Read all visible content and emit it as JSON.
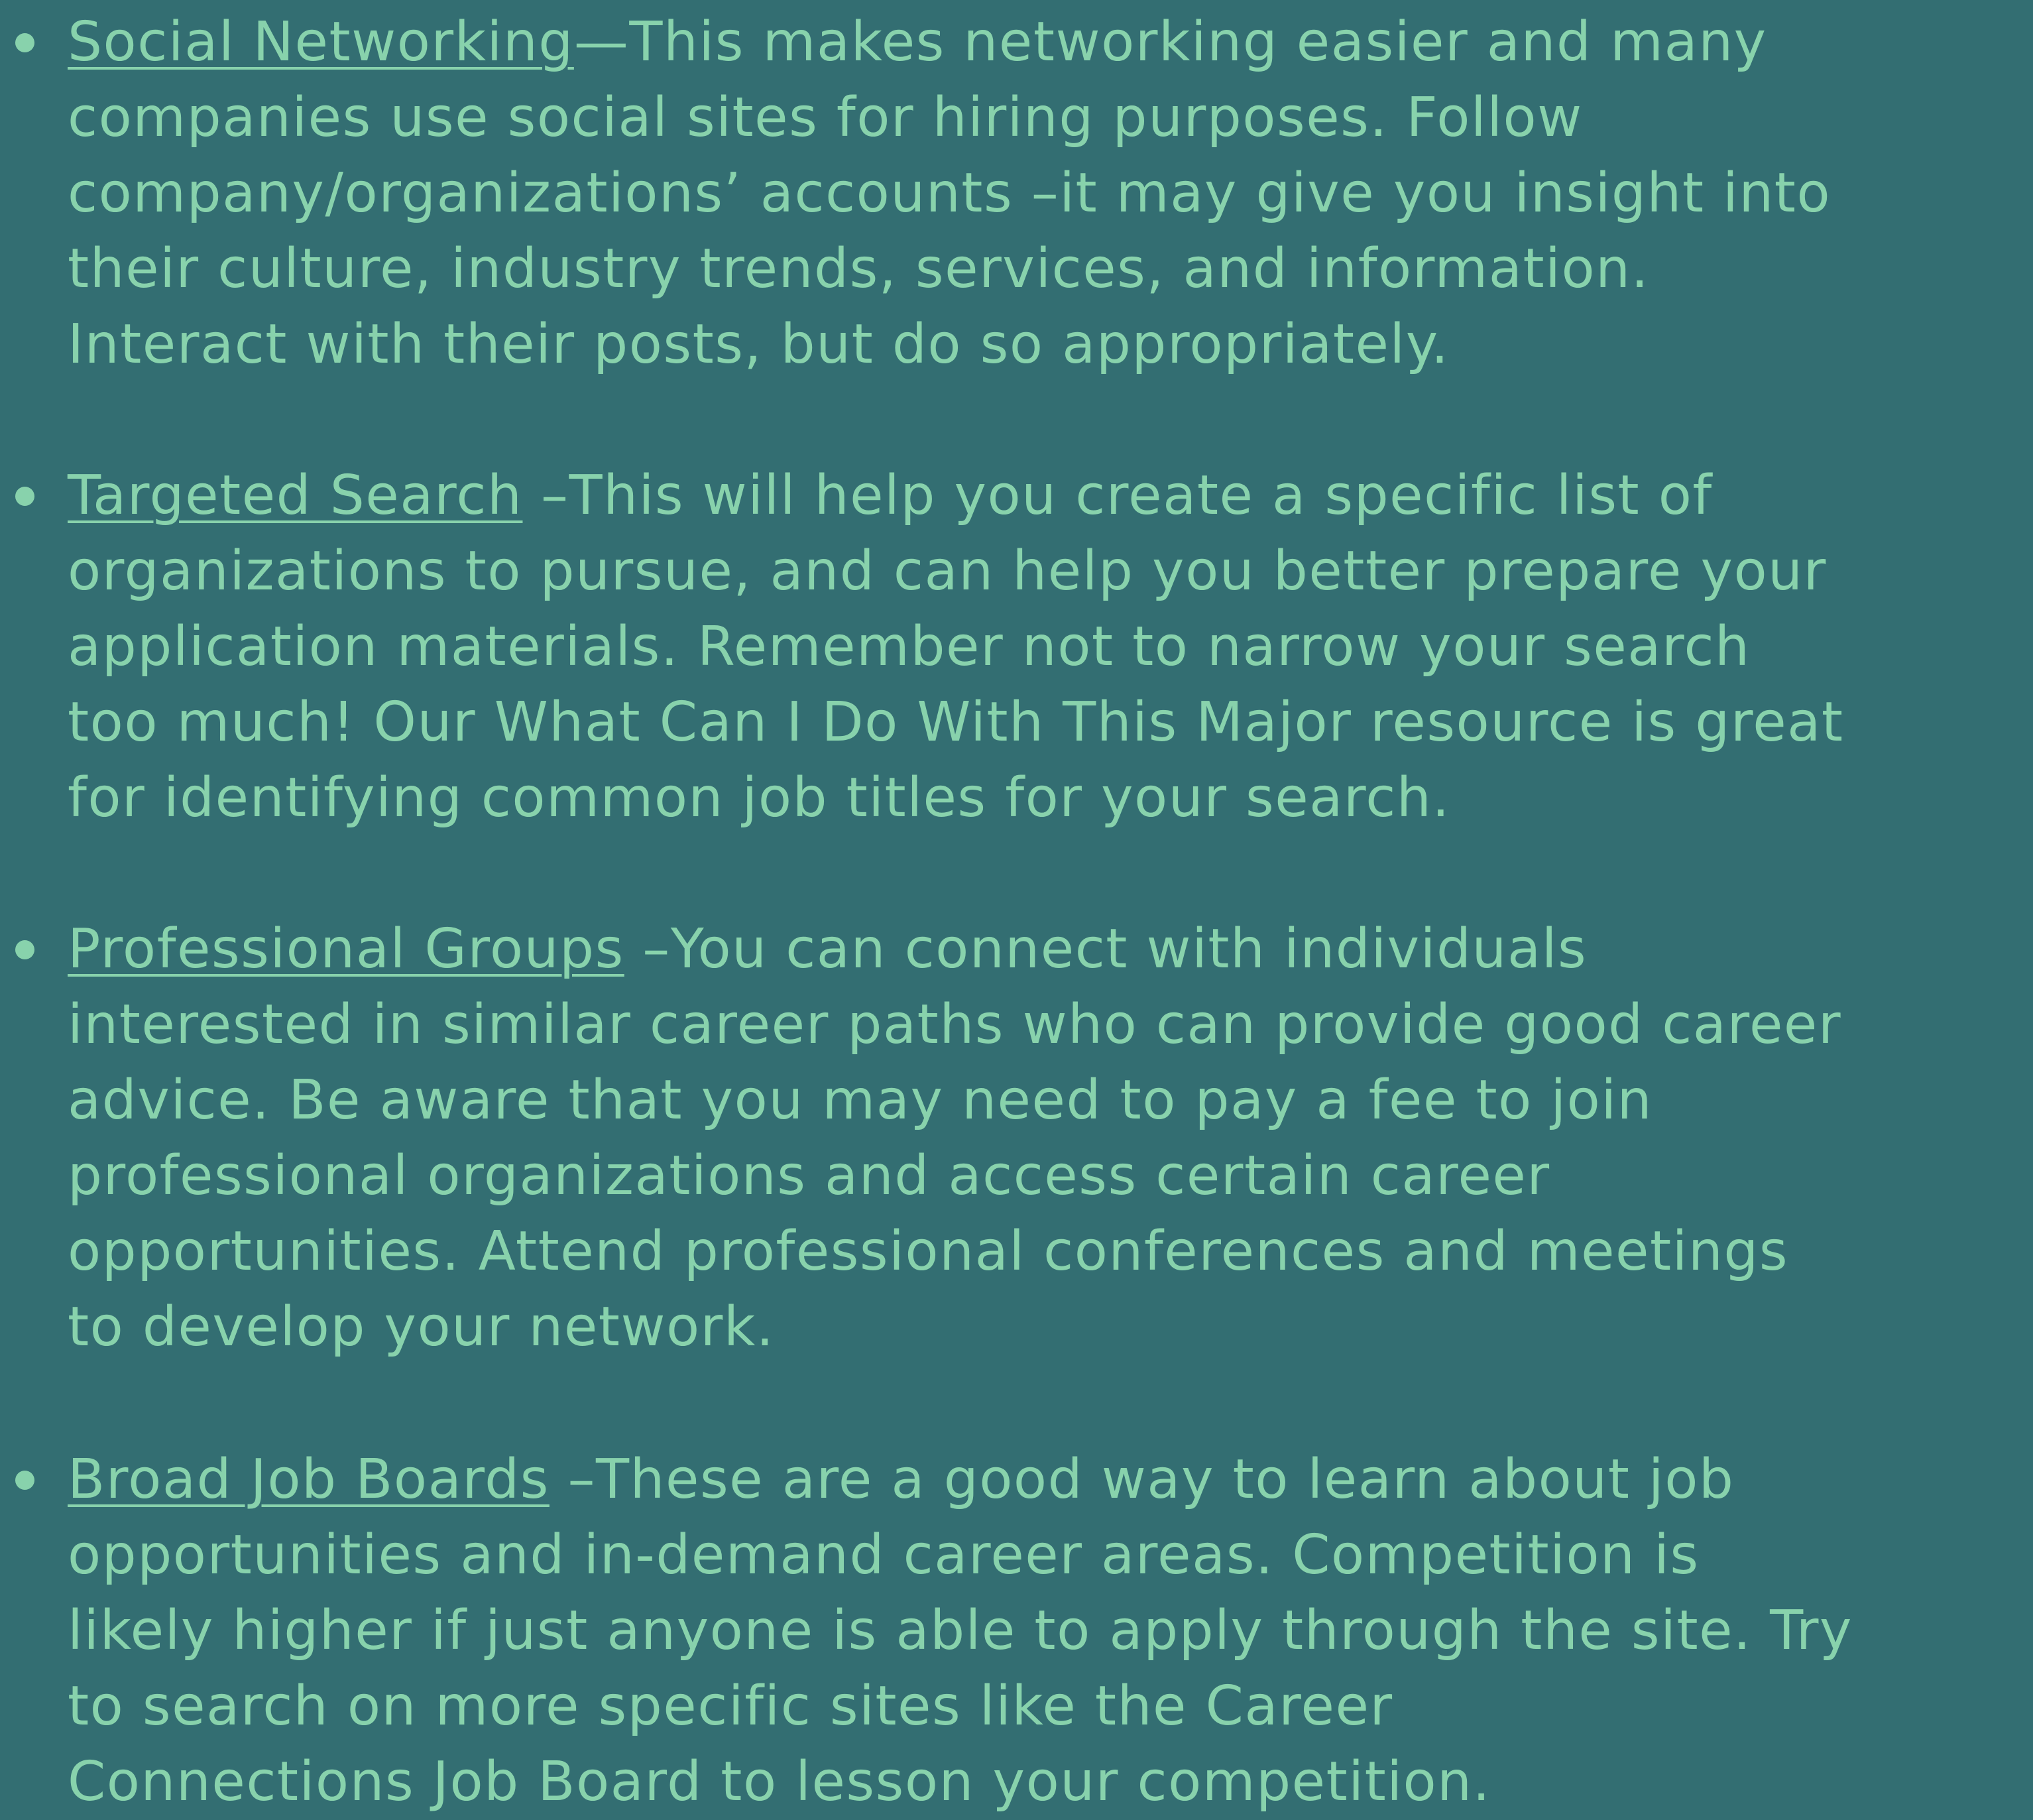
{
  "items": [
    {
      "link": "Social Networking",
      "lines": [
        "—This makes networking easier and many",
        "companies use social sites for hiring purposes. Follow",
        "company/organizations’ accounts –it may give you insight into",
        "their culture, industry trends, services, and information.",
        "Interact with their posts, but do so appropriately."
      ]
    },
    {
      "link": "Targeted Search",
      "lines": [
        " –This will help you create a specific list of",
        "organizations to pursue, and can help you better prepare your",
        "application materials. Remember not to narrow your search",
        "too much! Our What Can I Do With This Major resource is great",
        "for identifying common job titles for your search."
      ]
    },
    {
      "link": "Professional Groups",
      "lines": [
        " –You can connect with individuals",
        "interested in similar career paths who can provide good career",
        "advice. Be aware that you may need to pay a fee to join",
        "professional organizations and access certain career",
        "opportunities. Attend professional conferences and meetings",
        "to develop your network."
      ]
    },
    {
      "link": "Broad Job Boards",
      "lines": [
        " –These are a good way to learn about job",
        "opportunities and in-demand career areas. Competition is",
        "likely higher if just anyone is able to apply through the site. Try",
        "to search on more specific sites like the Career",
        "Connections Job Board to lesson your competition."
      ]
    }
  ]
}
